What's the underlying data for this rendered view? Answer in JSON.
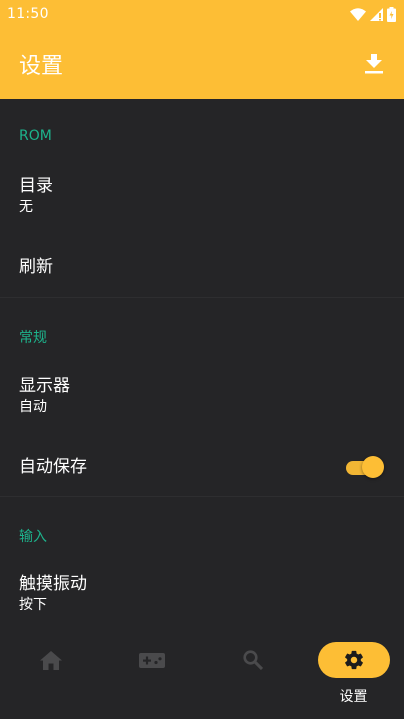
{
  "status_bar": {
    "time": "11:50",
    "icons": [
      "wifi-icon",
      "signal-icon",
      "battery-icon"
    ]
  },
  "app_bar": {
    "title": "设置",
    "action_icon": "download-icon"
  },
  "sections": [
    {
      "header": "ROM",
      "rows": [
        {
          "title": "目录",
          "subtitle": "无"
        },
        {
          "title": "刷新"
        }
      ]
    },
    {
      "header": "常规",
      "rows": [
        {
          "title": "显示器",
          "subtitle": "自动"
        },
        {
          "title": "自动保存",
          "toggle": true
        }
      ]
    },
    {
      "header": "输入",
      "rows": [
        {
          "title": "触摸振动",
          "subtitle": "按下"
        }
      ]
    }
  ],
  "bottom_nav": {
    "items": [
      {
        "icon": "home-icon",
        "label": ""
      },
      {
        "icon": "gamepad-icon",
        "label": ""
      },
      {
        "icon": "search-icon",
        "label": ""
      },
      {
        "icon": "gear-icon",
        "label": "设置",
        "active": true
      }
    ]
  },
  "colors": {
    "accent": "#FDBE35",
    "section_header": "#1DB38C",
    "background": "#252527",
    "nav_icon_inactive": "#4a4a4c"
  }
}
